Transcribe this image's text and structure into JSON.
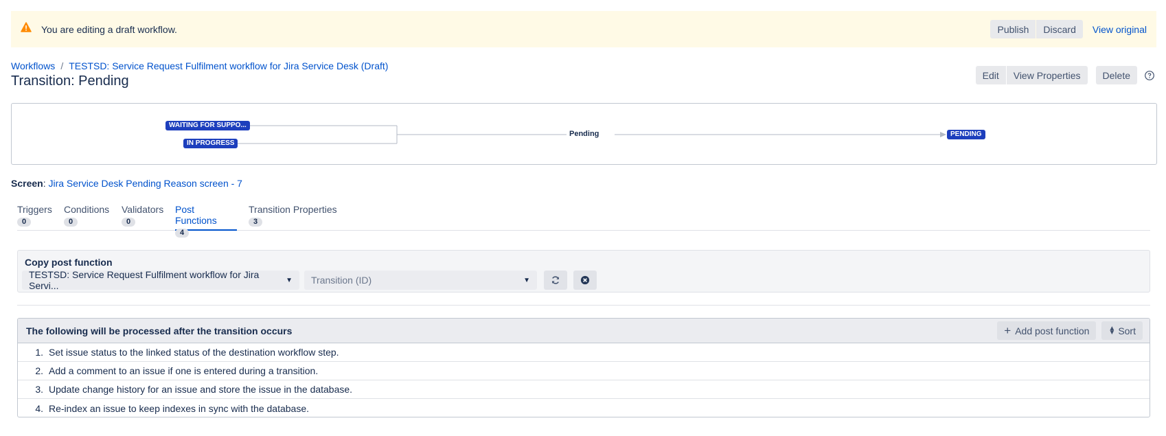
{
  "banner": {
    "text": "You are editing a draft workflow.",
    "publish_label": "Publish",
    "discard_label": "Discard",
    "view_original_label": "View original"
  },
  "breadcrumb": {
    "workflows": "Workflows",
    "separator": "/",
    "workflow_name": "TESTSD: Service Request Fulfilment workflow for Jira Service Desk (Draft)"
  },
  "title": "Transition: Pending",
  "header_actions": {
    "edit_label": "Edit",
    "view_properties_label": "View Properties",
    "delete_label": "Delete"
  },
  "diagram": {
    "from_statuses": [
      "WAITING FOR SUPPO...",
      "IN PROGRESS"
    ],
    "transition_name": "Pending",
    "to_status": "PENDING"
  },
  "screen": {
    "label": "Screen",
    "value": "Jira Service Desk Pending Reason screen - 7"
  },
  "tabs": [
    {
      "label": "Triggers",
      "count": "0",
      "active": false
    },
    {
      "label": "Conditions",
      "count": "0",
      "active": false
    },
    {
      "label": "Validators",
      "count": "0",
      "active": false
    },
    {
      "label": "Post Functions",
      "count": "4",
      "active": true
    },
    {
      "label": "Transition Properties",
      "count": "3",
      "active": false
    }
  ],
  "copy_post_function": {
    "title": "Copy post function",
    "workflow_select_value": "TESTSD: Service Request Fulfilment workflow for Jira Servi...",
    "transition_select_placeholder": "Transition (ID)"
  },
  "post_functions": {
    "header": "The following will be processed after the transition occurs",
    "add_label": "Add post function",
    "sort_label": "Sort",
    "items": [
      {
        "num": "1.",
        "text": "Set issue status to the linked status of the destination workflow step."
      },
      {
        "num": "2.",
        "text": "Add a comment to an issue if one is entered during a transition."
      },
      {
        "num": "3.",
        "text": "Update change history for an issue and store the issue in the database."
      },
      {
        "num": "4.",
        "text": "Re-index an issue to keep indexes in sync with the database."
      }
    ]
  },
  "colors": {
    "banner_bg": "#fffae6",
    "warning_icon": "#ff8b00",
    "link": "#0052cc",
    "status_lozenge": "#1d3fbd"
  },
  "icons": {
    "warning": "warning-icon",
    "help": "help-icon",
    "refresh": "refresh-icon",
    "clear": "clear-icon",
    "add": "plus-icon",
    "sort": "sort-icon"
  }
}
